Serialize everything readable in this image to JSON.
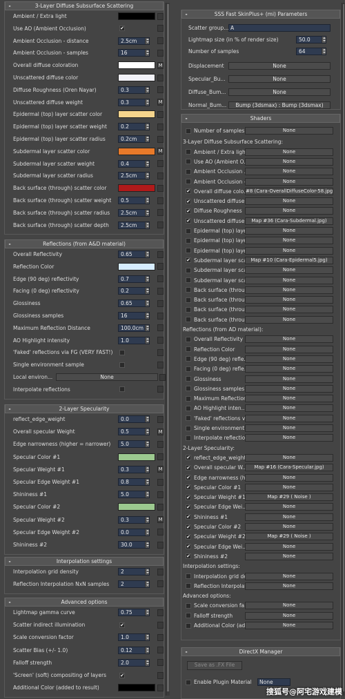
{
  "left": {
    "sss": {
      "title": "3-Layer Diffuse Subsurface Scattering",
      "rows": [
        {
          "label": "Ambient / Extra light",
          "type": "color",
          "color": "#000000"
        },
        {
          "label": "Use AO (Ambient Occlusion)",
          "type": "check",
          "value": "✔"
        },
        {
          "label": "Ambient Occlusion - distance",
          "type": "spin",
          "value": "2.5cm"
        },
        {
          "label": "Ambient Occlusion - samples",
          "type": "spin",
          "value": "16"
        },
        {
          "label": "Overall diffuse coloration",
          "type": "color",
          "color": "#ffffff",
          "m": "M"
        },
        {
          "label": "Unscattered diffuse color",
          "type": "color",
          "color": "#f2f2f8"
        },
        {
          "label": "Diffuse Roughness (Oren Nayar)",
          "type": "spin",
          "value": "0.3"
        },
        {
          "label": "Unscattered diffuse weight",
          "type": "spin",
          "value": "0.3",
          "m": "M"
        },
        {
          "label": "Epidermal (top) layer scatter color",
          "type": "color",
          "color": "#f5d48c"
        },
        {
          "label": "Epidermal (top) layer scatter weight",
          "type": "spin",
          "value": "0.2"
        },
        {
          "label": "Epidermal (top) layer scatter radius",
          "type": "spin",
          "value": "0.2cm"
        },
        {
          "label": "Subdermal layer scatter color",
          "type": "color",
          "color": "#e87a2a",
          "m": "M"
        },
        {
          "label": "Subdermal layer scatter weight",
          "type": "spin",
          "value": "0.4"
        },
        {
          "label": "Subdermal layer scatter radius",
          "type": "spin",
          "value": "2.5cm"
        },
        {
          "label": "Back surface (through) scatter color",
          "type": "color",
          "color": "#b01a1a"
        },
        {
          "label": "Back surface (through) scatter weight",
          "type": "spin",
          "value": "0.5"
        },
        {
          "label": "Back surface (through) scatter radius",
          "type": "spin",
          "value": "2.5cm"
        },
        {
          "label": "Back surface (through) scatter depth",
          "type": "spin",
          "value": "2.5cm"
        }
      ]
    },
    "refl": {
      "title": "Reflections (from A&D material)",
      "rows": [
        {
          "label": "Overall Reflectivity",
          "type": "spin",
          "value": "0.65"
        },
        {
          "label": "Reflection Color",
          "type": "color",
          "color": "#d6ecff"
        },
        {
          "label": "Edge (90 deg) reflectivity",
          "type": "spin",
          "value": "0.7"
        },
        {
          "label": "Facing (0 deg) reflectivity",
          "type": "spin",
          "value": "0.2"
        },
        {
          "label": "Glossiness",
          "type": "spin",
          "value": "0.65"
        },
        {
          "label": "Glossiness samples",
          "type": "spin",
          "value": "16"
        },
        {
          "label": "Maximum Reflection Distance",
          "type": "spin",
          "value": "100.0cm"
        },
        {
          "label": "AO Highlight intensity",
          "type": "spin",
          "value": "1.0"
        },
        {
          "label": "'Faked' reflections via FG (VERY FAST!)",
          "type": "check",
          "value": ""
        },
        {
          "label": "Single environment sample",
          "type": "check",
          "value": ""
        },
        {
          "label": "Local environ...",
          "type": "button",
          "value": "None"
        },
        {
          "label": "Interpolate reflections",
          "type": "check",
          "value": ""
        }
      ]
    },
    "spec": {
      "title": "2-Layer Specularity",
      "rows": [
        {
          "label": "reflect_edge_weight",
          "type": "spin",
          "value": "0.0"
        },
        {
          "label": "Overall specular Weight",
          "type": "spin",
          "value": "0.5",
          "m": "M"
        },
        {
          "label": "Edge narrowness (higher = narrower)",
          "type": "spin",
          "value": "5.0"
        },
        {
          "label": "Specular Color #1",
          "type": "color",
          "color": "#9cc98f"
        },
        {
          "label": "Specular Weight #1",
          "type": "spin",
          "value": "0.3",
          "m": "M"
        },
        {
          "label": "Specular Edge Weight #1",
          "type": "spin",
          "value": "0.8"
        },
        {
          "label": "Shininess #1",
          "type": "spin",
          "value": "5.0"
        },
        {
          "label": "Specular Color #2",
          "type": "color",
          "color": "#9cc98f"
        },
        {
          "label": "Specular Weight #2",
          "type": "spin",
          "value": "0.3",
          "m": "M"
        },
        {
          "label": "Specular Edge Weight #2",
          "type": "spin",
          "value": "0.0"
        },
        {
          "label": "Shininess #2",
          "type": "spin",
          "value": "30.0"
        }
      ]
    },
    "interp": {
      "title": "Interpolation settings",
      "rows": [
        {
          "label": "Interpolation grid density",
          "type": "spin",
          "value": "2"
        },
        {
          "label": "Reflection Interpolation NxN samples",
          "type": "spin",
          "value": "2"
        }
      ]
    },
    "adv": {
      "title": "Advanced options",
      "rows": [
        {
          "label": "Lightmap gamma curve",
          "type": "spin",
          "value": "0.75"
        },
        {
          "label": "Scatter indirect illumination",
          "type": "check",
          "value": "✔"
        },
        {
          "label": "Scale conversion factor",
          "type": "spin",
          "value": "1.0"
        },
        {
          "label": "Scatter Bias (+/- 1.0)",
          "type": "spin",
          "value": "0.12"
        },
        {
          "label": "Falloff strength",
          "type": "spin",
          "value": "2.0"
        },
        {
          "label": "'Screen' (soft) compositing of layers",
          "type": "check",
          "value": "✔"
        },
        {
          "label": "Additional Color (added to result)",
          "type": "color",
          "color": "#000000"
        }
      ]
    }
  },
  "right": {
    "params": {
      "title": "SSS Fast SkinPlus+ (mi) Parameters",
      "scatter_group_label": "Scatter group...",
      "scatter_group_value": "A",
      "lightmap_label": "Lightmap size (in % of render size)",
      "lightmap_value": "50.0",
      "samples_label": "Number of samples",
      "samples_value": "64",
      "maps": [
        {
          "label": "Displacement",
          "value": "None"
        },
        {
          "label": "Specular_Bu...",
          "value": "None"
        },
        {
          "label": "Diffuse_Bum...",
          "value": "None"
        },
        {
          "label": "Normal_Bum...",
          "value": "Bump (3dsmax) : Bump (3dsmax)"
        }
      ]
    },
    "shaders": {
      "title": "Shaders",
      "number_of_samples": {
        "label": "Number of samples",
        "value": "None",
        "checked": ""
      },
      "sss_heading": "3-Layer Diffuse Subsurface Scattering:",
      "sss": [
        {
          "label": "Ambient / Extra light",
          "value": "None",
          "checked": ""
        },
        {
          "label": "Use AO (Ambient O...",
          "value": "None",
          "checked": ""
        },
        {
          "label": "Ambient Occlusion ...",
          "value": "None",
          "checked": ""
        },
        {
          "label": "Ambient Occlusion -...",
          "value": "None",
          "checked": ""
        },
        {
          "label": "Overall diffuse colo...",
          "value": "#8 (Cara-OverallDiffuseColor-58.jpg)",
          "checked": "✔"
        },
        {
          "label": "Unscattered diffuse ...",
          "value": "None",
          "checked": "✔"
        },
        {
          "label": "Diffuse Roughness",
          "value": "None",
          "checked": "✔"
        },
        {
          "label": "Unscattered diffuse ...",
          "value": "Map #36 (Cara-Subdermal.jpg)",
          "checked": "✔"
        },
        {
          "label": "Epidermal (top) layer...",
          "value": "None",
          "checked": ""
        },
        {
          "label": "Epidermal (top) layer...",
          "value": "None",
          "checked": ""
        },
        {
          "label": "Epidermal (top) layer...",
          "value": "None",
          "checked": ""
        },
        {
          "label": "Subdermal layer sca...",
          "value": "Map #10 (Cara-Epidermal5.jpg)",
          "checked": "✔"
        },
        {
          "label": "Subdermal layer sca...",
          "value": "None",
          "checked": ""
        },
        {
          "label": "Subdermal layer sca...",
          "value": "None",
          "checked": ""
        },
        {
          "label": "Back surface (throu...",
          "value": "None",
          "checked": ""
        },
        {
          "label": "Back surface (throu...",
          "value": "None",
          "checked": ""
        },
        {
          "label": "Back surface (throu...",
          "value": "None",
          "checked": ""
        },
        {
          "label": "Back surface (throu...",
          "value": "None",
          "checked": ""
        }
      ],
      "refl_heading": "Reflections (from AD material):",
      "refl": [
        {
          "label": "Overall Reflectivity",
          "value": "None",
          "checked": ""
        },
        {
          "label": "Reflection Color",
          "value": "None",
          "checked": ""
        },
        {
          "label": "Edge (90 deg) refle...",
          "value": "None",
          "checked": ""
        },
        {
          "label": "Facing (0 deg) refle...",
          "value": "None",
          "checked": ""
        },
        {
          "label": "Glossiness",
          "value": "None",
          "checked": ""
        },
        {
          "label": "Glossiness samples",
          "value": "None",
          "checked": ""
        },
        {
          "label": "Maximum Reflection...",
          "value": "None",
          "checked": ""
        },
        {
          "label": "AO Highlight inten...",
          "value": "None",
          "checked": ""
        },
        {
          "label": "'Faked' reflections v...",
          "value": "None",
          "checked": ""
        },
        {
          "label": "Single environment ...",
          "value": "None",
          "checked": ""
        },
        {
          "label": "Interpolate reflections",
          "value": "None",
          "checked": ""
        }
      ],
      "spec_heading": "2-Layer Specularity:",
      "spec": [
        {
          "label": "reflect_edge_weight",
          "value": "None",
          "checked": "✔"
        },
        {
          "label": "Overall specular W...",
          "value": "Map #16 (Cara-Specular.jpg)",
          "checked": "✔"
        },
        {
          "label": "Edge narrowness (h...",
          "value": "None",
          "checked": "✔"
        },
        {
          "label": "Specular Color #1",
          "value": "None",
          "checked": "✔"
        },
        {
          "label": "Specular Weight #1",
          "value": "Map #29  ( Noise )",
          "checked": "✔"
        },
        {
          "label": "Specular Edge Wei...",
          "value": "None",
          "checked": "✔"
        },
        {
          "label": "Shininess #1",
          "value": "None",
          "checked": "✔"
        },
        {
          "label": "Specular Color #2",
          "value": "None",
          "checked": "✔"
        },
        {
          "label": "Specular Weight #2",
          "value": "Map #29  ( Noise )",
          "checked": "✔"
        },
        {
          "label": "Specular Edge Wei...",
          "value": "None",
          "checked": "✔"
        },
        {
          "label": "Shininess #2",
          "value": "None",
          "checked": "✔"
        }
      ],
      "interp_heading": "Interpolation settings:",
      "interp": [
        {
          "label": "Interpolation grid de...",
          "value": "None",
          "checked": ""
        },
        {
          "label": "Reflection Interpolat...",
          "value": "None",
          "checked": ""
        }
      ],
      "adv_heading": "Advanced options:",
      "adv": [
        {
          "label": "Scale conversion fa...",
          "value": "None",
          "checked": ""
        },
        {
          "label": "Falloff strength",
          "value": "None",
          "checked": ""
        },
        {
          "label": "Additional Color (ad...",
          "value": "None",
          "checked": ""
        }
      ]
    },
    "directx": {
      "title": "DirectX Manager",
      "save_button": "Save as .FX File",
      "enable_label": "Enable Plugin Material",
      "dropdown_value": "None"
    },
    "watermark": "搜狐号@阿宅游戏建模"
  }
}
